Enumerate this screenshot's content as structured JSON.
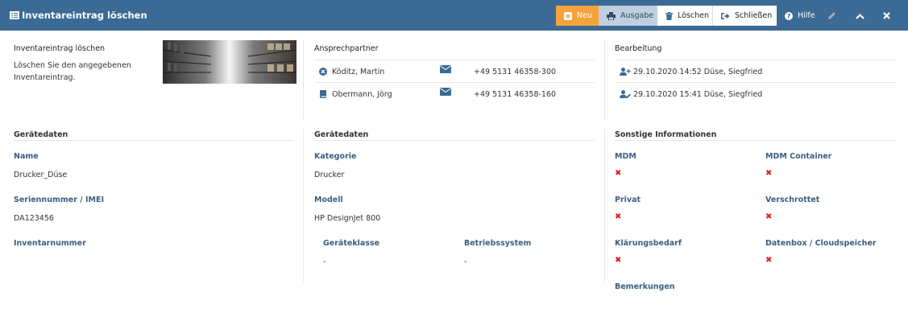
{
  "window": {
    "title": "Inventareintrag löschen",
    "title_icon": "list-icon"
  },
  "toolbar": {
    "new_label": "Neu",
    "print_label": "Ausgabe",
    "delete_label": "Löschen",
    "close_label": "Schließen",
    "help_label": "Hilfe",
    "edit_icon": "pencil-icon",
    "collapse_icon": "chevron-up-icon",
    "dismiss_icon": "close-icon"
  },
  "intro": {
    "heading": "Inventareintrag löschen",
    "description_line1": "Löschen Sie den angegebenen",
    "description_line2": "Inventareintrag.",
    "image": "archive-shelves-photo"
  },
  "contacts": {
    "heading": "Ansprechpartner",
    "items": [
      {
        "name": "Köditz, Martin",
        "icon": "circle-x-icon",
        "mail_icon": "envelope-icon",
        "phone": "+49 5131 46358-300"
      },
      {
        "name": "Obermann, Jörg",
        "icon": "book-icon",
        "mail_icon": "envelope-icon",
        "phone": "+49 5131 46358-160"
      }
    ]
  },
  "editing": {
    "heading": "Bearbeitung",
    "items": [
      {
        "icon": "user-plus-icon",
        "text": "29.10.2020 14:52 Düse, Siegfried"
      },
      {
        "icon": "user-edit-icon",
        "text": "29.10.2020 15:41 Düse, Siegfried"
      }
    ]
  },
  "device_left": {
    "heading": "Gerätedaten",
    "name_label": "Name",
    "name_value": "Drucker_Düse",
    "serial_label": "Seriennummer / IMEI",
    "serial_value": "DA123456",
    "inventory_label": "Inventarnummer",
    "inventory_value": ""
  },
  "device_mid": {
    "heading": "Gerätedaten",
    "category_label": "Kategorie",
    "category_value": "Drucker",
    "model_label": "Modell",
    "model_value": "HP DesignJet 800",
    "class_label": "Geräteklasse",
    "class_value": "-",
    "os_label": "Betriebssystem",
    "os_value": "-"
  },
  "other": {
    "heading": "Sonstige Informationen",
    "mdm_label": "MDM",
    "mdm_container_label": "MDM Container",
    "private_label": "Privat",
    "scrapped_label": "Verschrottet",
    "clarification_label": "Klärungsbedarf",
    "databox_label": "Datenbox / Cloudspeicher",
    "remarks_label": "Bemerkungen",
    "false_mark": "✖",
    "false_color": "#e0201b"
  },
  "colors": {
    "titlebar": "#3b6a94",
    "new_button": "#f6a33d",
    "print_button": "#bfcfdf",
    "field_label": "#3b5e80",
    "contact_icon": "#3b6a94"
  }
}
